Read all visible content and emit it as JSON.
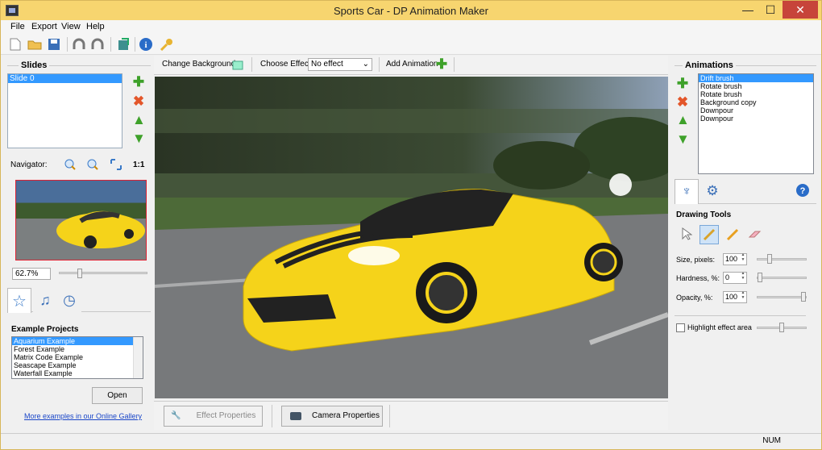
{
  "window": {
    "title": "Sports Car - DP Animation Maker",
    "min": "—",
    "max": "☐",
    "close": "✕"
  },
  "menu": [
    "File",
    "Export",
    "View",
    "Help"
  ],
  "toolbar_icons": [
    "new-file-icon",
    "open-folder-icon",
    "save-icon",
    "undo-icon",
    "redo-icon",
    "export-icon",
    "info-icon",
    "key-icon"
  ],
  "slides": {
    "header": "Slides",
    "items": [
      "Slide 0"
    ]
  },
  "navigator": {
    "label": "Navigator:",
    "one_to_one": "1:1",
    "zoom": "62.7%"
  },
  "example_projects": {
    "header": "Example Projects",
    "items": [
      "Aquarium Example",
      "Forest Example",
      "Matrix Code Example",
      "Seascape Example",
      "Waterfall Example"
    ],
    "open": "Open",
    "more_link": "More examples in our Online Gallery"
  },
  "canvas_toolbar": {
    "change_background": "Change Background",
    "choose_effect": "Choose Effect:",
    "effect_value": "No effect",
    "add_animation": "Add Animation"
  },
  "bottom": {
    "effect_properties": "Effect Properties",
    "camera_properties": "Camera Properties"
  },
  "animations": {
    "header": "Animations",
    "items": [
      "Drift brush",
      "Rotate brush",
      "Rotate brush",
      "Background copy",
      "Downpour",
      "Downpour"
    ]
  },
  "drawing": {
    "header": "Drawing Tools",
    "size_label": "Size, pixels:",
    "size": "100",
    "hardness_label": "Hardness, %:",
    "hardness": "0",
    "opacity_label": "Opacity, %:",
    "opacity": "100",
    "highlight": "Highlight effect area"
  },
  "status": {
    "num": "NUM"
  },
  "colors": {
    "title_bar": "#f7d56f",
    "selection": "#3399ff",
    "close": "#c7443a",
    "car": "#f5d31a"
  }
}
